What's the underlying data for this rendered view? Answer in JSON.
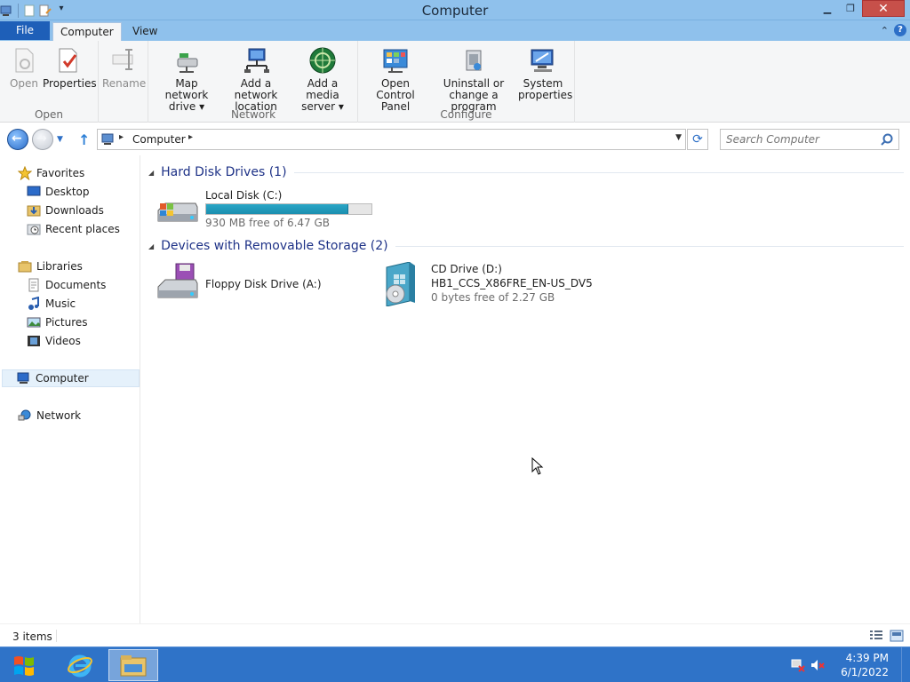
{
  "window": {
    "title": "Computer",
    "minimize": "▁",
    "maximize": "❐",
    "close": "✕"
  },
  "ribbon": {
    "tabs": {
      "file": "File",
      "computer": "Computer",
      "view": "View"
    },
    "groups": {
      "open": {
        "label": "Open",
        "open": "Open",
        "properties": "Properties",
        "rename": "Rename"
      },
      "network": {
        "label": "Network",
        "map_drive_line1": "Map network",
        "map_drive_line2": "drive ▾",
        "add_location_line1": "Add a network",
        "add_location_line2": "location",
        "media_server_line1": "Add a media",
        "media_server_line2": "server ▾"
      },
      "configure": {
        "label": "Configure",
        "control_panel_line1": "Open Control",
        "control_panel_line2": "Panel",
        "uninstall_line1": "Uninstall or",
        "uninstall_line2": "change a program",
        "system_line1": "System",
        "system_line2": "properties"
      }
    }
  },
  "address": {
    "crumb": "Computer",
    "search_placeholder": "Search Computer"
  },
  "nav": {
    "favorites": "Favorites",
    "desktop": "Desktop",
    "downloads": "Downloads",
    "recent": "Recent places",
    "libraries": "Libraries",
    "documents": "Documents",
    "music": "Music",
    "pictures": "Pictures",
    "videos": "Videos",
    "computer": "Computer",
    "network": "Network"
  },
  "content": {
    "hdd_group": "Hard Disk Drives (1)",
    "removable_group": "Devices with Removable Storage (2)",
    "local_disk": {
      "name": "Local Disk (C:)",
      "free": "930 MB free of 6.47 GB",
      "used_fraction": 0.86
    },
    "floppy": {
      "name": "Floppy Disk Drive (A:)"
    },
    "cd": {
      "name": "CD Drive (D:)",
      "label": "HB1_CCS_X86FRE_EN-US_DV5",
      "free": "0 bytes free of 2.27 GB"
    }
  },
  "status": {
    "count": "3 items"
  },
  "taskbar": {
    "time": "4:39 PM",
    "date": "6/1/2022"
  }
}
